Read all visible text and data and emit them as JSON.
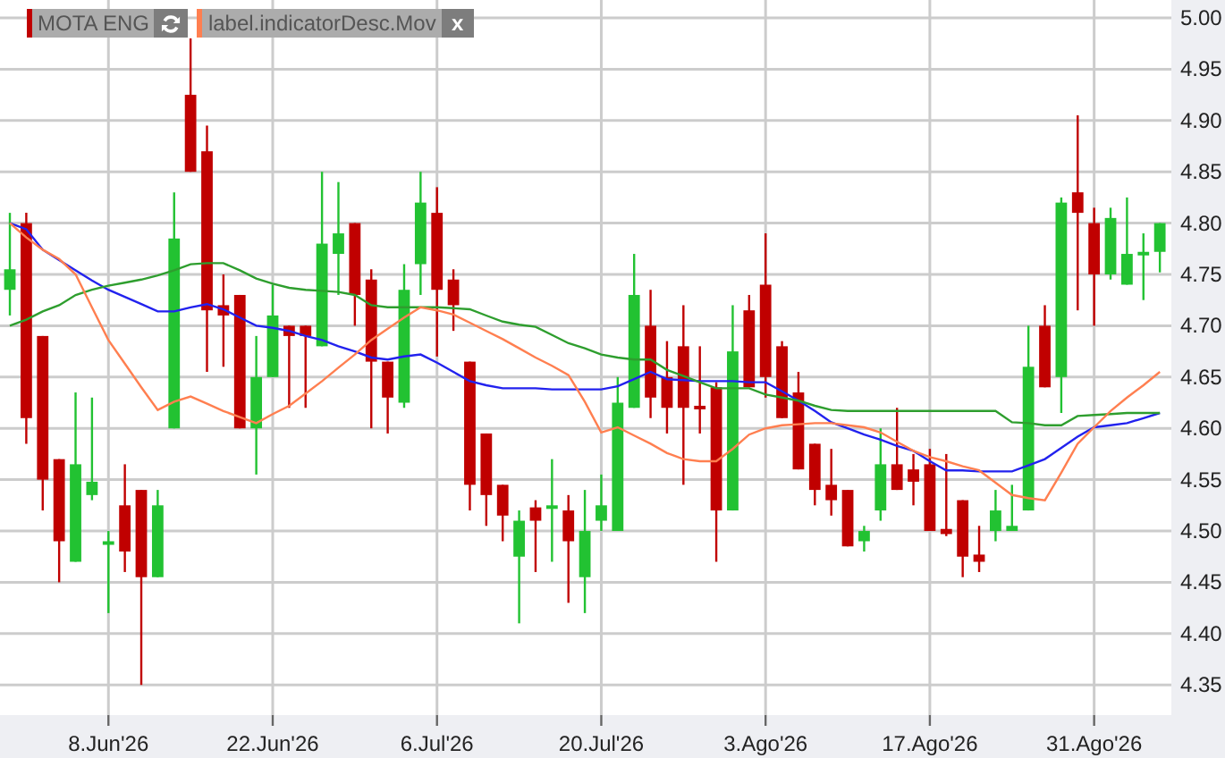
{
  "legend": [
    {
      "label": "MOTA ENG",
      "color": "#c00000",
      "kind": "refresh"
    },
    {
      "label": "label.indicatorDesc.Mov",
      "color": "#ff7f50",
      "kind": "close",
      "button": "x"
    }
  ],
  "chart": {
    "chart_data": {
      "type": "candlestick",
      "grid": true,
      "ylim": [
        4.3206,
        5.0174
      ],
      "categories": [
        null,
        null,
        null,
        null,
        null,
        null,
        "8.Jun'26",
        null,
        null,
        null,
        null,
        null,
        null,
        null,
        null,
        null,
        "22.Jun'26",
        null,
        null,
        null,
        null,
        null,
        null,
        null,
        null,
        null,
        "6.Jul'26",
        null,
        null,
        null,
        null,
        null,
        null,
        null,
        null,
        null,
        "20.Jul'26",
        null,
        null,
        null,
        null,
        null,
        null,
        null,
        null,
        null,
        "3.Ago'26",
        null,
        null,
        null,
        null,
        null,
        null,
        null,
        null,
        null,
        "17.Ago'26",
        null,
        null,
        null,
        null,
        null,
        null,
        null,
        null,
        null,
        "31.Ago'26",
        null,
        null,
        null,
        null
      ],
      "yticks": [
        {
          "value": 4.35,
          "label": "4.35"
        },
        {
          "value": 4.4,
          "label": "4.40"
        },
        {
          "value": 4.45,
          "label": "4.45"
        },
        {
          "value": 4.5,
          "label": "4.50"
        },
        {
          "value": 4.55,
          "label": "4.55"
        },
        {
          "value": 4.6,
          "label": "4.60"
        },
        {
          "value": 4.65,
          "label": "4.65"
        },
        {
          "value": 4.7,
          "label": "4.70"
        },
        {
          "value": 4.75,
          "label": "4.75"
        },
        {
          "value": 4.8,
          "label": "4.80"
        },
        {
          "value": 4.85,
          "label": "4.85"
        },
        {
          "value": 4.9,
          "label": "4.90"
        },
        {
          "value": 4.95,
          "label": "4.95"
        },
        {
          "value": 5.0,
          "label": "5.00"
        }
      ],
      "ohlc": [
        [
          4.735,
          4.81,
          4.71,
          4.755
        ],
        [
          4.8,
          4.81,
          4.585,
          4.61
        ],
        [
          4.69,
          4.69,
          4.52,
          4.55
        ],
        [
          4.57,
          4.57,
          4.45,
          4.49
        ],
        [
          4.47,
          4.635,
          4.47,
          4.565
        ],
        [
          4.535,
          4.63,
          4.53,
          4.548
        ],
        [
          4.487,
          4.5,
          4.42,
          4.49
        ],
        [
          4.525,
          4.565,
          4.46,
          4.48
        ],
        [
          4.54,
          4.54,
          4.35,
          4.455
        ],
        [
          4.455,
          4.54,
          4.455,
          4.525
        ],
        [
          4.6,
          4.83,
          4.6,
          4.785
        ],
        [
          4.925,
          4.98,
          4.85,
          4.85
        ],
        [
          4.87,
          4.895,
          4.655,
          4.715
        ],
        [
          4.72,
          4.75,
          4.66,
          4.71
        ],
        [
          4.73,
          4.73,
          4.6,
          4.6
        ],
        [
          4.6,
          4.69,
          4.555,
          4.65
        ],
        [
          4.65,
          4.74,
          4.65,
          4.71
        ],
        [
          4.7,
          4.7,
          4.62,
          4.69
        ],
        [
          4.7,
          4.7,
          4.62,
          4.69
        ],
        [
          4.68,
          4.85,
          4.68,
          4.78
        ],
        [
          4.77,
          4.84,
          4.73,
          4.79
        ],
        [
          4.8,
          4.8,
          4.7,
          4.73
        ],
        [
          4.745,
          4.755,
          4.6,
          4.665
        ],
        [
          4.665,
          4.665,
          4.595,
          4.63
        ],
        [
          4.625,
          4.76,
          4.62,
          4.735
        ],
        [
          4.76,
          4.85,
          4.73,
          4.82
        ],
        [
          4.81,
          4.835,
          4.67,
          4.735
        ],
        [
          4.745,
          4.755,
          4.695,
          4.72
        ],
        [
          4.665,
          4.665,
          4.52,
          4.545
        ],
        [
          4.595,
          4.595,
          4.505,
          4.535
        ],
        [
          4.545,
          4.545,
          4.49,
          4.515
        ],
        [
          4.475,
          4.52,
          4.41,
          4.51
        ],
        [
          4.523,
          4.53,
          4.46,
          4.51
        ],
        [
          4.523,
          4.57,
          4.47,
          4.525
        ],
        [
          4.52,
          4.535,
          4.43,
          4.49
        ],
        [
          4.455,
          4.54,
          4.42,
          4.5
        ],
        [
          4.51,
          4.555,
          4.5,
          4.525
        ],
        [
          4.5,
          4.65,
          4.5,
          4.625
        ],
        [
          4.62,
          4.77,
          4.62,
          4.73
        ],
        [
          4.7,
          4.735,
          4.61,
          4.63
        ],
        [
          4.65,
          4.685,
          4.595,
          4.62
        ],
        [
          4.68,
          4.72,
          4.545,
          4.62
        ],
        [
          4.622,
          4.68,
          4.595,
          4.62
        ],
        [
          4.64,
          4.645,
          4.47,
          4.52
        ],
        [
          4.52,
          4.72,
          4.52,
          4.675
        ],
        [
          4.715,
          4.73,
          4.64,
          4.64
        ],
        [
          4.74,
          4.79,
          4.63,
          4.65
        ],
        [
          4.68,
          4.685,
          4.61,
          4.61
        ],
        [
          4.635,
          4.655,
          4.56,
          4.56
        ],
        [
          4.585,
          4.585,
          4.525,
          4.54
        ],
        [
          4.545,
          4.58,
          4.515,
          4.53
        ],
        [
          4.54,
          4.54,
          4.485,
          4.485
        ],
        [
          4.49,
          4.505,
          4.48,
          4.5
        ],
        [
          4.52,
          4.6,
          4.51,
          4.565
        ],
        [
          4.565,
          4.62,
          4.54,
          4.54
        ],
        [
          4.56,
          4.575,
          4.525,
          4.548
        ],
        [
          4.565,
          4.58,
          4.5,
          4.5
        ],
        [
          4.502,
          4.575,
          4.495,
          4.497
        ],
        [
          4.53,
          4.53,
          4.455,
          4.475
        ],
        [
          4.477,
          4.505,
          4.46,
          4.47
        ],
        [
          4.5,
          4.54,
          4.49,
          4.52
        ],
        [
          4.5,
          4.545,
          4.5,
          4.505
        ],
        [
          4.52,
          4.7,
          4.52,
          4.66
        ],
        [
          4.7,
          4.72,
          4.64,
          4.64
        ],
        [
          4.65,
          4.825,
          4.615,
          4.82
        ],
        [
          4.83,
          4.905,
          4.715,
          4.81
        ],
        [
          4.8,
          4.815,
          4.7,
          4.75
        ],
        [
          4.75,
          4.815,
          4.745,
          4.805
        ],
        [
          4.74,
          4.825,
          4.74,
          4.77
        ],
        [
          4.77,
          4.79,
          4.725,
          4.772
        ],
        [
          4.772,
          4.8,
          4.752,
          4.8
        ]
      ],
      "series": [
        {
          "type": "line",
          "color": "#2222ee",
          "values": [
            4.8,
            4.794,
            4.774,
            4.764,
            4.754,
            4.744,
            4.735,
            4.728,
            4.721,
            4.714,
            4.714,
            4.718,
            4.721,
            4.716,
            4.708,
            4.7,
            4.698,
            4.695,
            4.69,
            4.686,
            4.68,
            4.675,
            4.669,
            4.667,
            4.67,
            4.672,
            4.664,
            4.655,
            4.646,
            4.642,
            4.639,
            4.639,
            4.639,
            4.638,
            4.638,
            4.638,
            4.638,
            4.641,
            4.648,
            4.655,
            4.648,
            4.647,
            4.646,
            4.646,
            4.646,
            4.645,
            4.645,
            4.636,
            4.627,
            4.617,
            4.606,
            4.6,
            4.594,
            4.589,
            4.583,
            4.578,
            4.568,
            4.559,
            4.559,
            4.558,
            4.558,
            4.558,
            4.564,
            4.57,
            4.581,
            4.592,
            4.601,
            4.603,
            4.605,
            4.61,
            4.615
          ]
        },
        {
          "type": "line",
          "color": "#2e9e2e",
          "values": [
            4.7,
            4.706,
            4.714,
            4.72,
            4.73,
            4.735,
            4.739,
            4.742,
            4.745,
            4.749,
            4.754,
            4.76,
            4.761,
            4.761,
            4.754,
            4.746,
            4.741,
            4.737,
            4.735,
            4.734,
            4.733,
            4.73,
            4.72,
            4.718,
            4.718,
            4.718,
            4.718,
            4.717,
            4.716,
            4.71,
            4.704,
            4.701,
            4.699,
            4.691,
            4.683,
            4.678,
            4.672,
            4.669,
            4.667,
            4.667,
            4.657,
            4.651,
            4.645,
            4.639,
            4.639,
            4.639,
            4.633,
            4.63,
            4.627,
            4.622,
            4.618,
            4.617,
            4.617,
            4.617,
            4.617,
            4.617,
            4.617,
            4.617,
            4.617,
            4.617,
            4.617,
            4.606,
            4.605,
            4.603,
            4.603,
            4.612,
            4.613,
            4.614,
            4.615,
            4.615,
            4.615
          ]
        },
        {
          "type": "line",
          "color": "#ff7f50",
          "values": [
            4.8,
            4.786,
            4.774,
            4.765,
            4.75,
            4.718,
            4.686,
            4.663,
            4.64,
            4.618,
            4.626,
            4.631,
            4.624,
            4.617,
            4.611,
            4.605,
            4.614,
            4.622,
            4.634,
            4.646,
            4.659,
            4.672,
            4.686,
            4.697,
            4.708,
            4.718,
            4.715,
            4.711,
            4.703,
            4.695,
            4.687,
            4.678,
            4.669,
            4.661,
            4.652,
            4.626,
            4.596,
            4.601,
            4.593,
            4.585,
            4.576,
            4.57,
            4.568,
            4.568,
            4.58,
            4.594,
            4.6,
            4.603,
            4.604,
            4.605,
            4.605,
            4.603,
            4.601,
            4.596,
            4.587,
            4.578,
            4.572,
            4.568,
            4.563,
            4.559,
            4.547,
            4.535,
            4.532,
            4.53,
            4.557,
            4.585,
            4.601,
            4.617,
            4.63,
            4.642,
            4.655
          ]
        }
      ]
    }
  }
}
